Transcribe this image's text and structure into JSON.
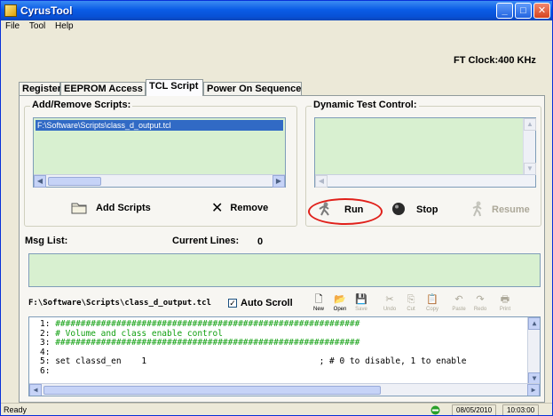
{
  "window": {
    "title": "CyrusTool"
  },
  "menu": [
    "File",
    "Tool",
    "Help"
  ],
  "fclock": "FT Clock:400 KHz",
  "tabs": [
    "Register",
    "EEPROM Access",
    "TCL Script",
    "Power On Sequence"
  ],
  "add_remove": {
    "label": "Add/Remove Scripts:",
    "selected_script": "F:\\Software\\Scripts\\class_d_output.tcl",
    "add_label": "Add Scripts",
    "remove_label": "Remove"
  },
  "dynamic": {
    "label": "Dynamic Test Control:",
    "run_label": "Run",
    "stop_label": "Stop",
    "resume_label": "Resume"
  },
  "msg": {
    "label": "Msg List:",
    "current_lines_label": "Current Lines:",
    "current_lines_value": "0"
  },
  "editor_toolbar": {
    "path": "F:\\Software\\Scripts\\class_d_output.tcl",
    "auto_scroll_label": "Auto Scroll",
    "buttons": [
      "New",
      "Open",
      "Save",
      "Undo",
      "Cut",
      "Copy",
      "Paste",
      "Redo",
      "Print"
    ]
  },
  "code": [
    {
      "no": "1:",
      "text": "############################################################"
    },
    {
      "no": "2:",
      "text": "# Volume and class enable control"
    },
    {
      "no": "3:",
      "text": "############################################################"
    },
    {
      "no": "4:",
      "text": ""
    },
    {
      "no": "5:",
      "text": "set classd_en    1                                  ; # 0 to disable, 1 to enable"
    },
    {
      "no": "6:",
      "text": ""
    }
  ],
  "status": {
    "text": "Ready",
    "date": "08/05/2010",
    "time": "10:03:00"
  }
}
